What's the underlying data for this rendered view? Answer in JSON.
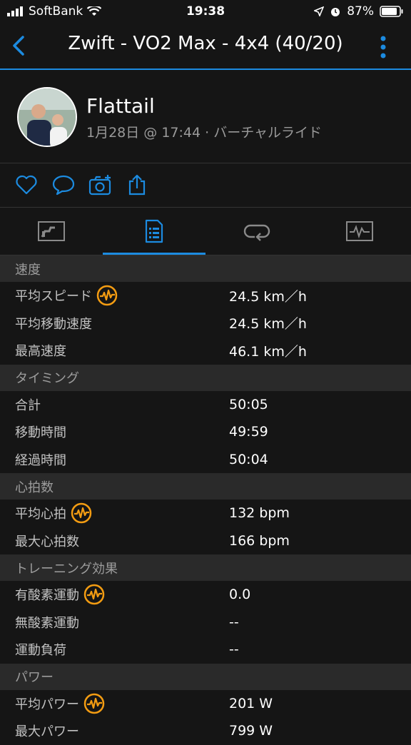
{
  "status_bar": {
    "carrier": "SoftBank",
    "time": "19:38",
    "battery": "87%"
  },
  "nav": {
    "title": "Zwift - VO2 Max - 4x4 (40/20)"
  },
  "profile": {
    "name": "Flattail",
    "meta": "1月28日 @ 17:44 · バーチャルライド"
  },
  "colors": {
    "accent": "#1c8be0",
    "badge": "#f39c12",
    "background": "#151515",
    "section": "#2a2a2a"
  },
  "actions": [
    "heart-icon",
    "comment-icon",
    "camera-add-icon",
    "share-icon"
  ],
  "tabs": [
    "chart-tab",
    "stats-tab",
    "laps-tab",
    "graph-tab"
  ],
  "sections": {
    "speed": {
      "title": "速度",
      "rows": [
        {
          "label": "平均スピード",
          "value": "24.5 km／h"
        },
        {
          "label": "平均移動速度",
          "value": "24.5 km／h"
        },
        {
          "label": "最高速度",
          "value": "46.1 km／h"
        }
      ]
    },
    "timing": {
      "title": "タイミング",
      "rows": [
        {
          "label": "合計",
          "value": "50:05"
        },
        {
          "label": "移動時間",
          "value": "49:59"
        },
        {
          "label": "経過時間",
          "value": "50:04"
        }
      ]
    },
    "heart": {
      "title": "心拍数",
      "rows": [
        {
          "label": "平均心拍",
          "value": "132 bpm"
        },
        {
          "label": "最大心拍数",
          "value": "166 bpm"
        }
      ]
    },
    "training": {
      "title": "トレーニング効果",
      "rows": [
        {
          "label": "有酸素運動",
          "value": "0.0"
        },
        {
          "label": "無酸素運動",
          "value": "--"
        },
        {
          "label": "運動負荷",
          "value": "--"
        }
      ]
    },
    "power": {
      "title": "パワー",
      "rows": [
        {
          "label": "平均パワー",
          "value": "201 W"
        },
        {
          "label": "最大パワー",
          "value": "799 W"
        }
      ]
    }
  }
}
